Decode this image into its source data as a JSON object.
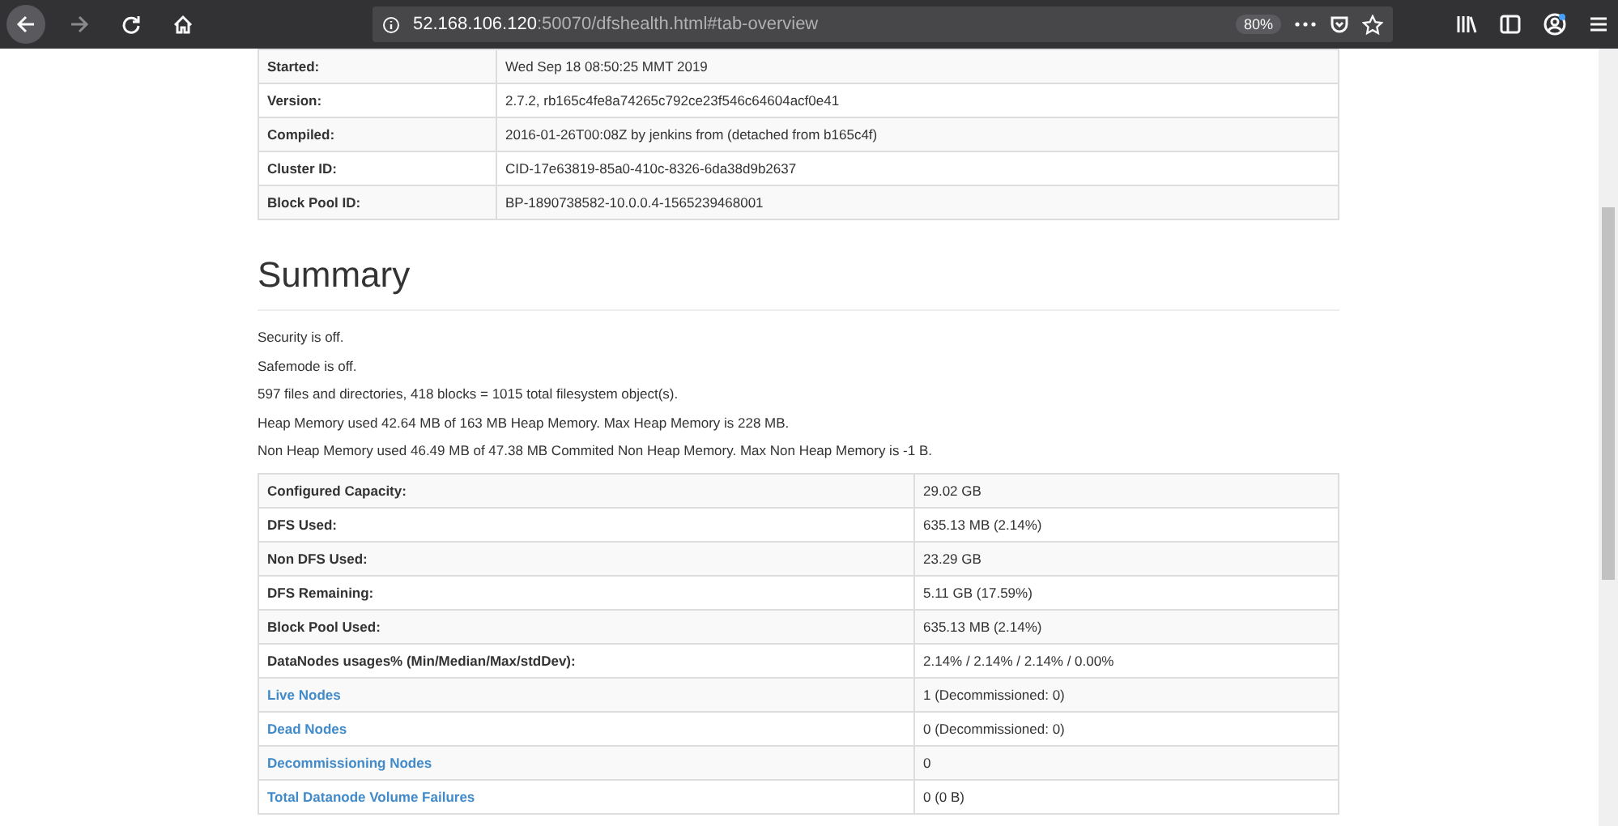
{
  "toolbar": {
    "url_host": "52.168.106.120",
    "url_rest": ":50070/dfshealth.html#tab-overview",
    "zoom": "80%"
  },
  "overview_table": {
    "rows": [
      {
        "label": "Started:",
        "value": "Wed Sep 18 08:50:25 MMT 2019",
        "kind": "text"
      },
      {
        "label": "Version:",
        "value": "2.7.2, rb165c4fe8a74265c792ce23f546c64604acf0e41",
        "kind": "text"
      },
      {
        "label": "Compiled:",
        "value": "2016-01-26T00:08Z by jenkins from (detached from b165c4f)",
        "kind": "text"
      },
      {
        "label": "Cluster ID:",
        "value": "CID-17e63819-85a0-410c-8326-6da38d9b2637",
        "kind": "text"
      },
      {
        "label": "Block Pool ID:",
        "value": "BP-1890738582-10.0.0.4-1565239468001",
        "kind": "text"
      }
    ]
  },
  "summary": {
    "heading": "Summary",
    "lines": [
      "Security is off.",
      "Safemode is off.",
      "597 files and directories, 418 blocks = 1015 total filesystem object(s).",
      "Heap Memory used 42.64 MB of 163 MB Heap Memory. Max Heap Memory is 228 MB.",
      "Non Heap Memory used 46.49 MB of 47.38 MB Commited Non Heap Memory. Max Non Heap Memory is -1 B."
    ],
    "table": {
      "rows": [
        {
          "label": "Configured Capacity:",
          "value": "29.02 GB",
          "kind": "text"
        },
        {
          "label": "DFS Used:",
          "value": "635.13 MB (2.14%)",
          "kind": "text"
        },
        {
          "label": "Non DFS Used:",
          "value": "23.29 GB",
          "kind": "text"
        },
        {
          "label": "DFS Remaining:",
          "value": "5.11 GB (17.59%)",
          "kind": "text"
        },
        {
          "label": "Block Pool Used:",
          "value": "635.13 MB (2.14%)",
          "kind": "text"
        },
        {
          "label": "DataNodes usages% (Min/Median/Max/stdDev):",
          "value": "2.14% / 2.14% / 2.14% / 0.00%",
          "kind": "text"
        },
        {
          "label": "Live Nodes",
          "value": "1 (Decommissioned: 0)",
          "kind": "link"
        },
        {
          "label": "Dead Nodes",
          "value": "0 (Decommissioned: 0)",
          "kind": "link"
        },
        {
          "label": "Decommissioning Nodes",
          "value": "0",
          "kind": "link"
        },
        {
          "label": "Total Datanode Volume Failures",
          "value": "0 (0 B)",
          "kind": "link"
        }
      ]
    }
  }
}
